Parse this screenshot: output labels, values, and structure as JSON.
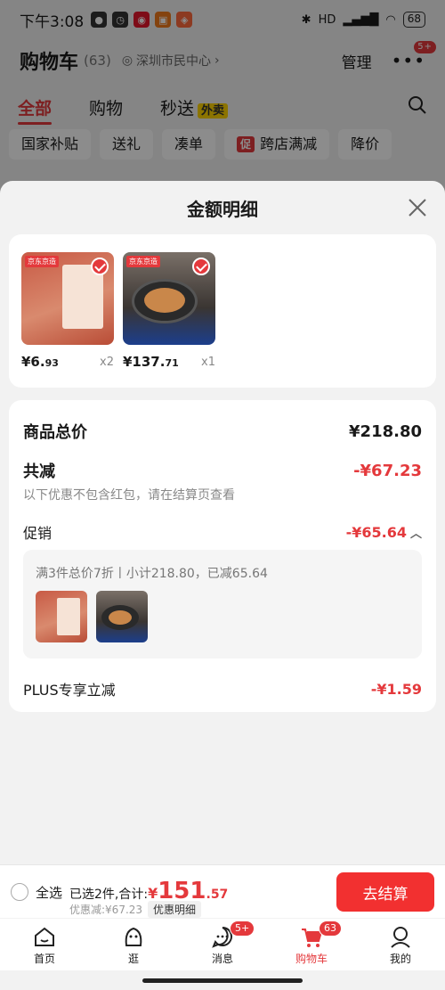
{
  "status_bar": {
    "time": "下午3:08",
    "battery": "68",
    "network": "HD"
  },
  "header": {
    "title": "购物车",
    "count": "(63)",
    "location": "深圳市民中心",
    "manage": "管理",
    "more_badge": "5+"
  },
  "tabs": [
    {
      "label": "全部"
    },
    {
      "label": "购物"
    },
    {
      "label": "秒送"
    }
  ],
  "tabs_extra": {
    "flash_tag": "外卖"
  },
  "chips": [
    {
      "label": "国家补贴"
    },
    {
      "label": "送礼"
    },
    {
      "label": "凑单"
    },
    {
      "label": "跨店满减",
      "tag": "促"
    },
    {
      "label": "降价"
    }
  ],
  "sheet": {
    "title": "金额明细",
    "products": [
      {
        "price_main": "¥6.",
        "price_dec": "93",
        "qty": "x2",
        "tag": "京东京造"
      },
      {
        "price_main": "¥137.",
        "price_dec": "71",
        "qty": "x1",
        "tag": "京东京造"
      }
    ],
    "total_label": "商品总价",
    "total_value": "¥218.80",
    "reduce_label": "共减",
    "reduce_value": "-¥67.23",
    "note": "以下优惠不包含红包，请在结算页查看",
    "promo_label": "促销",
    "promo_value": "-¥65.64",
    "promo_desc": "满3件总价7折丨小计218.80，已减65.64",
    "plus_label": "PLUS专享立减",
    "plus_value": "-¥1.59"
  },
  "checkout": {
    "select_all": "全选",
    "summary_prefix": "已选2件,合计:",
    "total_yen": "¥",
    "total_int": "151",
    "total_dec": ".57",
    "discount_text": "优惠减:¥67.23",
    "detail_chip": "优惠明细",
    "button": "去结算"
  },
  "nav": [
    {
      "label": "首页",
      "icon": "home-icon"
    },
    {
      "label": "逛",
      "icon": "explore-icon"
    },
    {
      "label": "消息",
      "icon": "message-icon",
      "badge": "5+"
    },
    {
      "label": "购物车",
      "icon": "cart-icon",
      "badge": "63",
      "active": true
    },
    {
      "label": "我的",
      "icon": "profile-icon"
    }
  ],
  "colors": {
    "accent": "#e4393c",
    "button": "#f23030",
    "flash_tag": "#ffd400"
  }
}
